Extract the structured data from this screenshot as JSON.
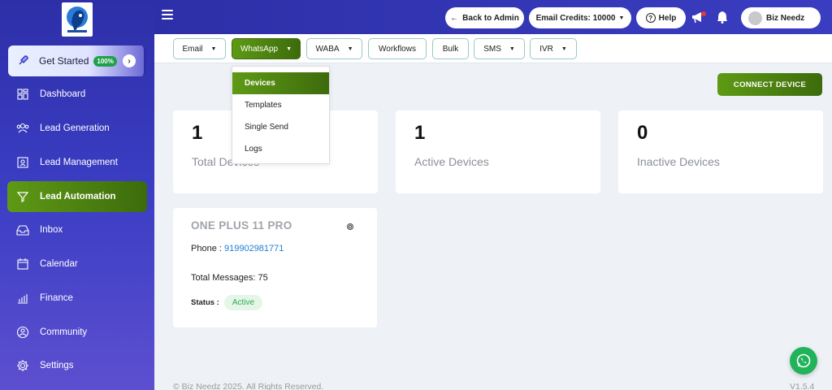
{
  "sidebar": {
    "get_started": {
      "label": "Get Started",
      "badge": "100%"
    },
    "items": [
      {
        "label": "Dashboard",
        "icon": "dashboard-icon"
      },
      {
        "label": "Lead Generation",
        "icon": "people-icon"
      },
      {
        "label": "Lead Management",
        "icon": "contact-card-icon"
      },
      {
        "label": "Lead Automation",
        "icon": "funnel-icon",
        "active": true
      },
      {
        "label": "Inbox",
        "icon": "inbox-icon"
      },
      {
        "label": "Calendar",
        "icon": "calendar-icon"
      },
      {
        "label": "Finance",
        "icon": "finance-chart-icon"
      },
      {
        "label": "Community",
        "icon": "community-icon"
      },
      {
        "label": "Settings",
        "icon": "gear-icon"
      }
    ]
  },
  "topbar": {
    "back_label": "Back to Admin",
    "email_credits": "Email Credits: 10000",
    "help_label": "Help",
    "user_name": "Biz Needz"
  },
  "tabs": [
    {
      "label": "Email"
    },
    {
      "label": "WhatsApp",
      "active": true
    },
    {
      "label": "WABA"
    },
    {
      "label": "Workflows"
    },
    {
      "label": "Bulk"
    },
    {
      "label": "SMS"
    },
    {
      "label": "IVR"
    }
  ],
  "dropdown": {
    "items": [
      {
        "label": "Devices",
        "active": true
      },
      {
        "label": "Templates"
      },
      {
        "label": "Single Send"
      },
      {
        "label": "Logs"
      }
    ]
  },
  "connect_device_label": "CONNECT DEVICE",
  "stats": [
    {
      "value": "1",
      "label": "Total Devices"
    },
    {
      "value": "1",
      "label": "Active Devices"
    },
    {
      "value": "0",
      "label": "Inactive Devices"
    }
  ],
  "device": {
    "name": "ONE PLUS 11 PRO",
    "phone_label": "Phone :",
    "phone_value": "919902981771",
    "total_messages": "Total Messages: 75",
    "status_label": "Status :",
    "status_value": "Active"
  },
  "footer": {
    "copyright": "© Biz Needz 2025. All Rights Reserved.",
    "version": "V1.5.4"
  },
  "colors": {
    "sidebar": "#2d2fa8",
    "accent_green": "#4a7f10",
    "link_blue": "#1e7fd0",
    "whatsapp_green": "#21b35a"
  }
}
